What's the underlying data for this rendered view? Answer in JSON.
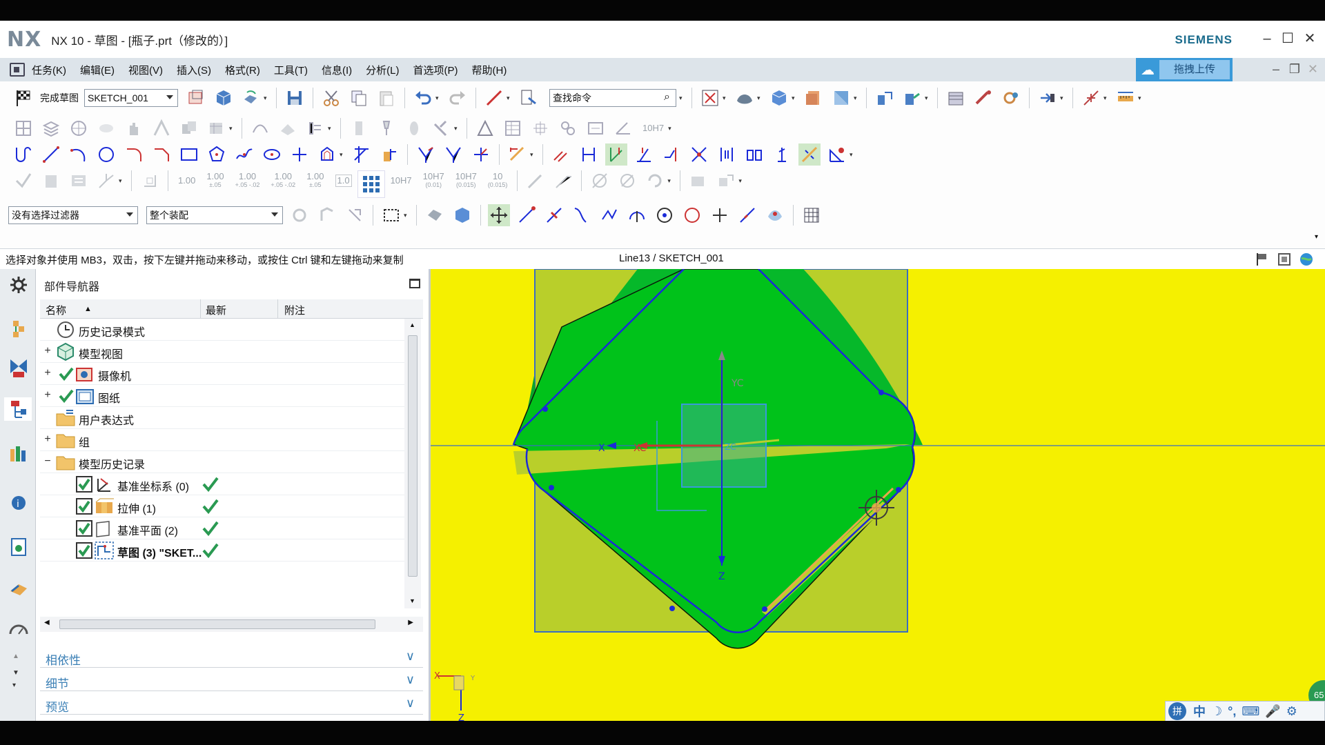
{
  "window": {
    "logo": "NX",
    "title": "NX 10 - 草图 - [瓶子.prt（修改的）]",
    "brand": "SIEMENS"
  },
  "menu": {
    "items": [
      "任务(K)",
      "编辑(E)",
      "视图(V)",
      "插入(S)",
      "格式(R)",
      "工具(T)",
      "信息(I)",
      "分析(L)",
      "首选项(P)",
      "帮助(H)"
    ],
    "upload_label": "拖拽上传"
  },
  "toolbar": {
    "finish_sketch": "完成草图",
    "sketch_name": "SKETCH_001",
    "search_placeholder": "查找命令",
    "selection_filter": "没有选择过滤器",
    "assembly_scope": "整个装配",
    "dimension_values": {
      "d1": "1.00",
      "d2": "1.00",
      "d2_tol": "±.05",
      "d3": "1.00",
      "d3_tol": "+.05 -.02",
      "d4": "1.00",
      "d4_tol": "+.05 -.02",
      "d5": "1.00",
      "d5_tol": "±.05",
      "d6": "1.0",
      "d7": "10H7",
      "d8": "10H7",
      "d8_tol": "(0.01)",
      "d9": "10H7",
      "d9_tol": "(0.015)",
      "d10": "10",
      "d10_tol": "(0.015)",
      "d11": "10H7"
    }
  },
  "status": {
    "prompt": "选择对象并使用 MB3，双击，按下左键并拖动来移动，或按住 Ctrl 键和左键拖动来复制",
    "selected_object": "Line13 / SKETCH_001"
  },
  "part_navigator": {
    "title": "部件导航器",
    "columns": [
      "名称",
      "最新",
      "附注"
    ],
    "sort_indicator": "▲",
    "rows": [
      {
        "label": "历史记录模式",
        "expander": "",
        "checked": false,
        "icon": "clock-icon",
        "indent": 0,
        "latest": false
      },
      {
        "label": "模型视图",
        "expander": "+",
        "checked": false,
        "icon": "model-view-icon",
        "indent": 0,
        "latest": false
      },
      {
        "label": "摄像机",
        "expander": "+",
        "checked": true,
        "icon": "camera-icon",
        "indent": 0,
        "latest": false
      },
      {
        "label": "图纸",
        "expander": "+",
        "checked": true,
        "icon": "drawing-icon",
        "indent": 0,
        "latest": false
      },
      {
        "label": "用户表达式",
        "expander": "",
        "checked": false,
        "icon": "expression-folder-icon",
        "indent": 0,
        "latest": false
      },
      {
        "label": "组",
        "expander": "+",
        "checked": false,
        "icon": "folder-icon",
        "indent": 0,
        "latest": false
      },
      {
        "label": "模型历史记录",
        "expander": "−",
        "checked": false,
        "icon": "folder-icon",
        "indent": 0,
        "latest": false
      },
      {
        "label": "基准坐标系 (0)",
        "expander": "",
        "checked": true,
        "icon": "datum-csys-icon",
        "indent": 1,
        "latest": true
      },
      {
        "label": "拉伸 (1)",
        "expander": "",
        "checked": true,
        "icon": "extrude-icon",
        "indent": 1,
        "latest": true
      },
      {
        "label": "基准平面 (2)",
        "expander": "",
        "checked": true,
        "icon": "datum-plane-icon",
        "indent": 1,
        "latest": true
      },
      {
        "label": "草图 (3) \"SKET...",
        "expander": "",
        "checked": true,
        "icon": "sketch-icon",
        "indent": 1,
        "latest": true
      }
    ],
    "sections": [
      "相依性",
      "细节",
      "预览"
    ]
  },
  "canvas": {
    "axis_labels": {
      "xc": "XC",
      "yc": "YC",
      "zc": "ZC",
      "x": "X",
      "y": "Y",
      "z": "Z"
    },
    "colors": {
      "background": "#f5f000",
      "body": "#00c21a",
      "sketch": "#1a2ad8",
      "face": "#b9cf2a"
    }
  },
  "ime": {
    "badge": "拼",
    "items": [
      "中",
      "☽",
      "°,",
      "⌨",
      "🎤",
      "⚙"
    ]
  },
  "side_badge": "65"
}
